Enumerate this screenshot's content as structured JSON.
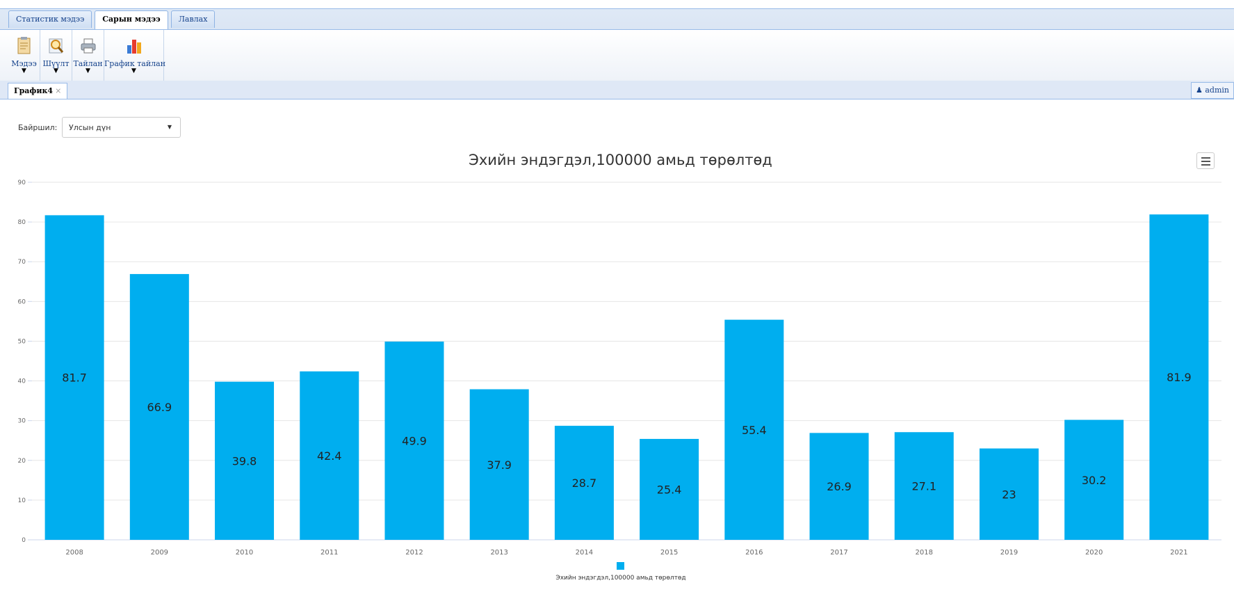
{
  "menu": {
    "tabs": [
      {
        "label": "Статистик мэдээ"
      },
      {
        "label": "Сарын мэдээ"
      },
      {
        "label": "Лавлах"
      }
    ],
    "ribbon": [
      {
        "label": "Мэдээ",
        "icon": "document-icon"
      },
      {
        "label": "Шүүлт",
        "icon": "search-icon"
      },
      {
        "label": "Тайлан",
        "icon": "printer-icon"
      },
      {
        "label": "График тайлан",
        "icon": "bar-chart-icon"
      }
    ]
  },
  "doc_tab": {
    "label": "График4",
    "close": "×"
  },
  "user": {
    "name": "admin"
  },
  "filter": {
    "label": "Байршил:",
    "value": "Улсын дүн"
  },
  "colors": {
    "bar": "#00aeef",
    "grid": "#e6e6e6"
  },
  "chart_data": {
    "type": "bar",
    "title": "Эхийн эндэгдэл,100000 амьд төрөлтөд",
    "categories": [
      "2008",
      "2009",
      "2010",
      "2011",
      "2012",
      "2013",
      "2014",
      "2015",
      "2016",
      "2017",
      "2018",
      "2019",
      "2020",
      "2021"
    ],
    "series": [
      {
        "name": "Эхийн эндэгдэл,100000 амьд төрөлтөд",
        "values": [
          81.7,
          66.9,
          39.8,
          42.4,
          49.9,
          37.9,
          28.7,
          25.4,
          55.4,
          26.9,
          27.1,
          23,
          30.2,
          81.9
        ]
      }
    ],
    "ylim": [
      0,
      90
    ],
    "yticks": [
      0,
      10,
      20,
      30,
      40,
      50,
      60,
      70,
      80,
      90
    ],
    "grid": true,
    "legend": "bottom-center",
    "data_labels": true
  }
}
